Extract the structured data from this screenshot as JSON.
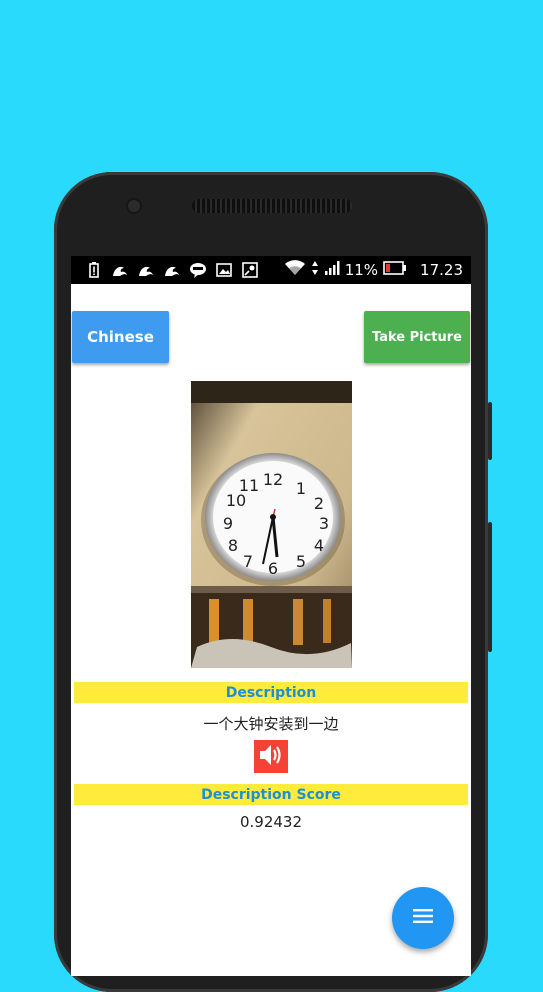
{
  "status_bar": {
    "battery": "11%",
    "time": "17.23",
    "notification_icons": [
      "battery-alert-icon",
      "uc-browser-icon",
      "uc-browser-icon",
      "uc-browser-icon",
      "line-app-icon",
      "gallery-icon",
      "maps-icon"
    ],
    "system_icons": [
      "wifi-icon",
      "signal-icon",
      "battery-low-icon"
    ]
  },
  "toolbar": {
    "language_button": "Chinese",
    "take_picture_button": "Take Picture"
  },
  "result": {
    "description_heading": "Description",
    "description_text": "一个大钟安装到一边",
    "score_heading": "Description Score",
    "score_value": "0.92432"
  },
  "colors": {
    "background": "#29dafd",
    "language_button": "#3e9bf0",
    "take_picture_button": "#4caf50",
    "heading_band": "#ffeb3b",
    "heading_text": "#1e8fd6",
    "speaker_button": "#f44336",
    "fab": "#2196f3"
  }
}
